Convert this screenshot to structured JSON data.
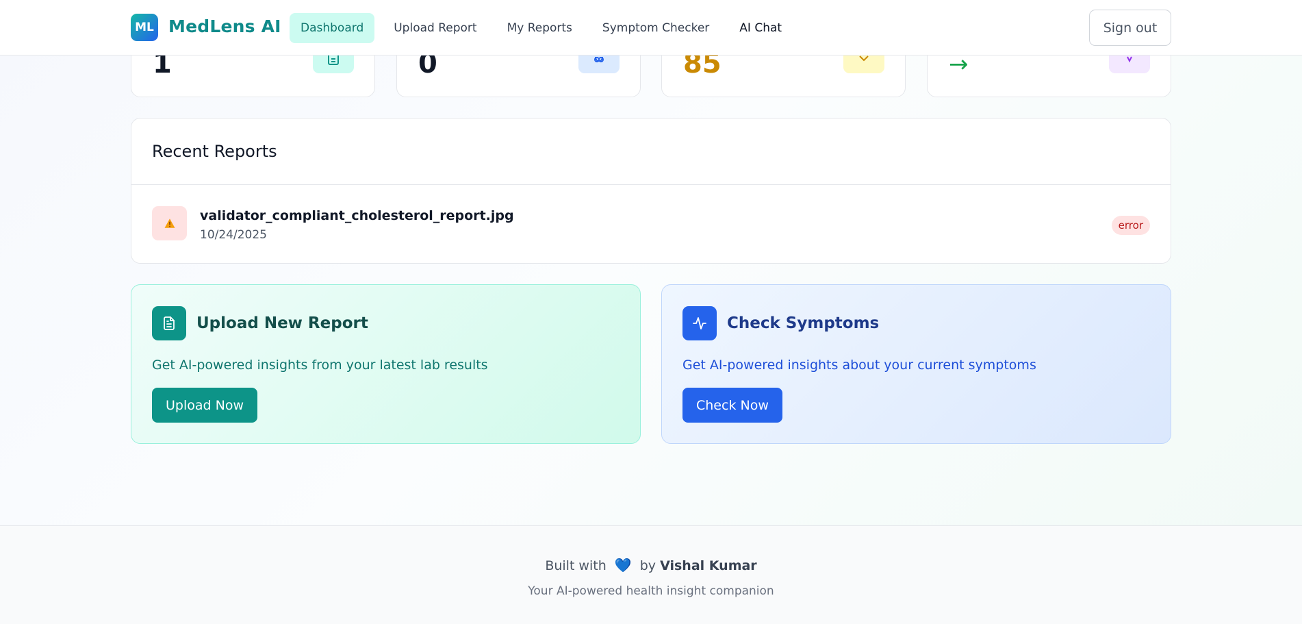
{
  "app": {
    "logo_badge": "ML",
    "name": "MedLens AI"
  },
  "nav": {
    "items": [
      {
        "label": "Dashboard",
        "active": true
      },
      {
        "label": "Upload Report",
        "active": false
      },
      {
        "label": "My Reports",
        "active": false
      },
      {
        "label": "Symptom Checker",
        "active": false
      },
      {
        "label": "AI Chat",
        "active": false
      }
    ],
    "signout_label": "Sign out"
  },
  "stats": [
    {
      "value": "1",
      "icon": "document-icon",
      "color": "#111827",
      "icon_bg": "#ccfbf1"
    },
    {
      "value": "0",
      "icon": "brain-icon",
      "color": "#111827",
      "icon_bg": "#dbeafe"
    },
    {
      "value": "85",
      "icon": "heart-icon",
      "color": "#ca8a04",
      "icon_bg": "#fef9c3"
    },
    {
      "value": "→",
      "icon": "trend-icon",
      "color": "#16a34a",
      "icon_bg": "#f3e8ff"
    }
  ],
  "recent_reports": {
    "title": "Recent Reports",
    "items": [
      {
        "filename": "validator_compliant_cholesterol_report.jpg",
        "date": "10/24/2025",
        "status": "error",
        "icon": "warning-icon"
      }
    ]
  },
  "actions": {
    "upload": {
      "title": "Upload New Report",
      "description": "Get AI-powered insights from your latest lab results",
      "button": "Upload Now",
      "icon": "document-icon"
    },
    "symptoms": {
      "title": "Check Symptoms",
      "description": "Get AI-powered insights about your current symptoms",
      "button": "Check Now",
      "icon": "activity-icon"
    }
  },
  "footer": {
    "built_with": "Built with",
    "heart": "💙",
    "by": "by",
    "author": "Vishal Kumar",
    "tagline": "Your AI-powered health insight companion"
  },
  "colors": {
    "brand_teal": "#0d9488",
    "brand_blue": "#2563eb",
    "error_red": "#b91c1c"
  }
}
